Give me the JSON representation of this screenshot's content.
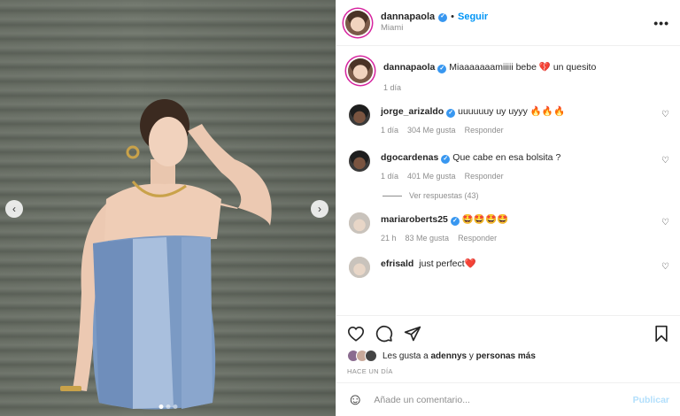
{
  "header": {
    "username": "dannapaola",
    "separator": "•",
    "follow_label": "Seguir",
    "location": "Miami",
    "more_label": "•••"
  },
  "caption": {
    "username": "dannapaola",
    "text": "Miaaaaaaamiiiii bebe 💔 un quesito",
    "time": "1 día"
  },
  "comments": [
    {
      "username": "jorge_arizaldo",
      "text": "uuuuuuy uy uyyy 🔥🔥🔥",
      "time": "1 día",
      "likes": "304 Me gusta",
      "reply": "Responder"
    },
    {
      "username": "dgocardenas",
      "text": "Que cabe en esa bolsita ?",
      "time": "1 día",
      "likes": "401 Me gusta",
      "reply": "Responder",
      "view_replies": "Ver respuestas (43)"
    },
    {
      "username": "mariaroberts25",
      "text": "🤩🤩🤩🤩",
      "time": "21 h",
      "likes": "83 Me gusta",
      "reply": "Responder"
    },
    {
      "username": "efrisald",
      "text": "just perfect❤️"
    }
  ],
  "likes": {
    "prefix": "Les gusta a",
    "user": "adennys",
    "conj": "y",
    "others": "personas más"
  },
  "timestamp": "HACE UN DÍA",
  "add_comment": {
    "emoji": "☺",
    "placeholder": "Añade un comentario...",
    "publish_label": "Publicar"
  },
  "media": {
    "prev_icon": "‹",
    "next_icon": "›"
  },
  "colors": {
    "accent": "#0095f6",
    "verified": "#3897f0",
    "muted": "#8e8e8e"
  }
}
